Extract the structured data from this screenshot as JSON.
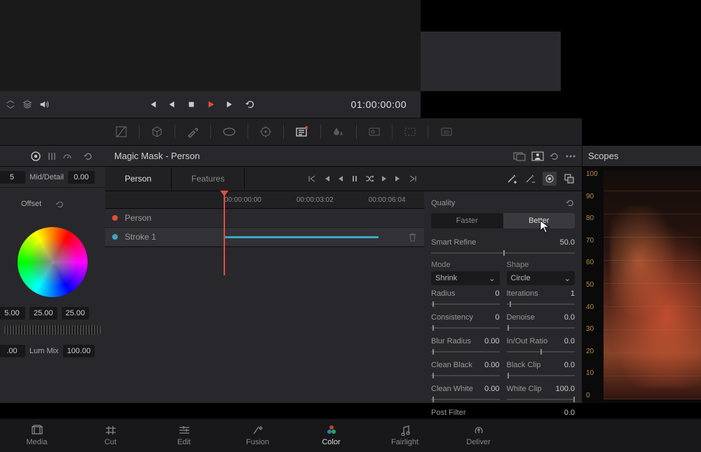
{
  "transport": {
    "timecode": "01:00:00:00"
  },
  "panel": {
    "title": "Magic Mask - Person"
  },
  "left": {
    "mid_detail_label": "Mid/Detail",
    "mid_detail_value": "0.00",
    "offset_label": "Offset",
    "nums": [
      "5.00",
      "25.00",
      "25.00"
    ],
    "lum_partial": ".00",
    "lum_label": "Lum Mix",
    "lum_value": "100.00"
  },
  "tabs": {
    "person": "Person",
    "features": "Features"
  },
  "ruler": {
    "t0": "00:00:00:00",
    "t1": "00:00:03:02",
    "t2": "00:00:06:04"
  },
  "tracks": {
    "person": "Person",
    "stroke": "Stroke 1"
  },
  "quality": {
    "title": "Quality",
    "faster": "Faster",
    "better": "Better",
    "smart_refine": "Smart Refine",
    "smart_refine_val": "50.0",
    "mode_label": "Mode",
    "mode_value": "Shrink",
    "shape_label": "Shape",
    "shape_value": "Circle",
    "radius": "Radius",
    "radius_val": "0",
    "iterations": "Iterations",
    "iterations_val": "1",
    "consistency": "Consistency",
    "consistency_val": "0",
    "denoise": "Denoise",
    "denoise_val": "0.0",
    "blur_radius": "Blur Radius",
    "blur_radius_val": "0.00",
    "inout": "In/Out Ratio",
    "inout_val": "0.0",
    "clean_black": "Clean Black",
    "clean_black_val": "0.00",
    "black_clip": "Black Clip",
    "black_clip_val": "0.0",
    "clean_white": "Clean White",
    "clean_white_val": "0.00",
    "white_clip": "White Clip",
    "white_clip_val": "100.0",
    "post_filter": "Post Filter",
    "post_filter_val": "0.0"
  },
  "scopes": {
    "title": "Scopes",
    "scale": [
      "100",
      "90",
      "80",
      "70",
      "60",
      "50",
      "40",
      "30",
      "20",
      "10",
      "0"
    ]
  },
  "nav": {
    "media": "Media",
    "cut": "Cut",
    "edit": "Edit",
    "fusion": "Fusion",
    "color": "Color",
    "fairlight": "Fairlight",
    "deliver": "Deliver"
  }
}
